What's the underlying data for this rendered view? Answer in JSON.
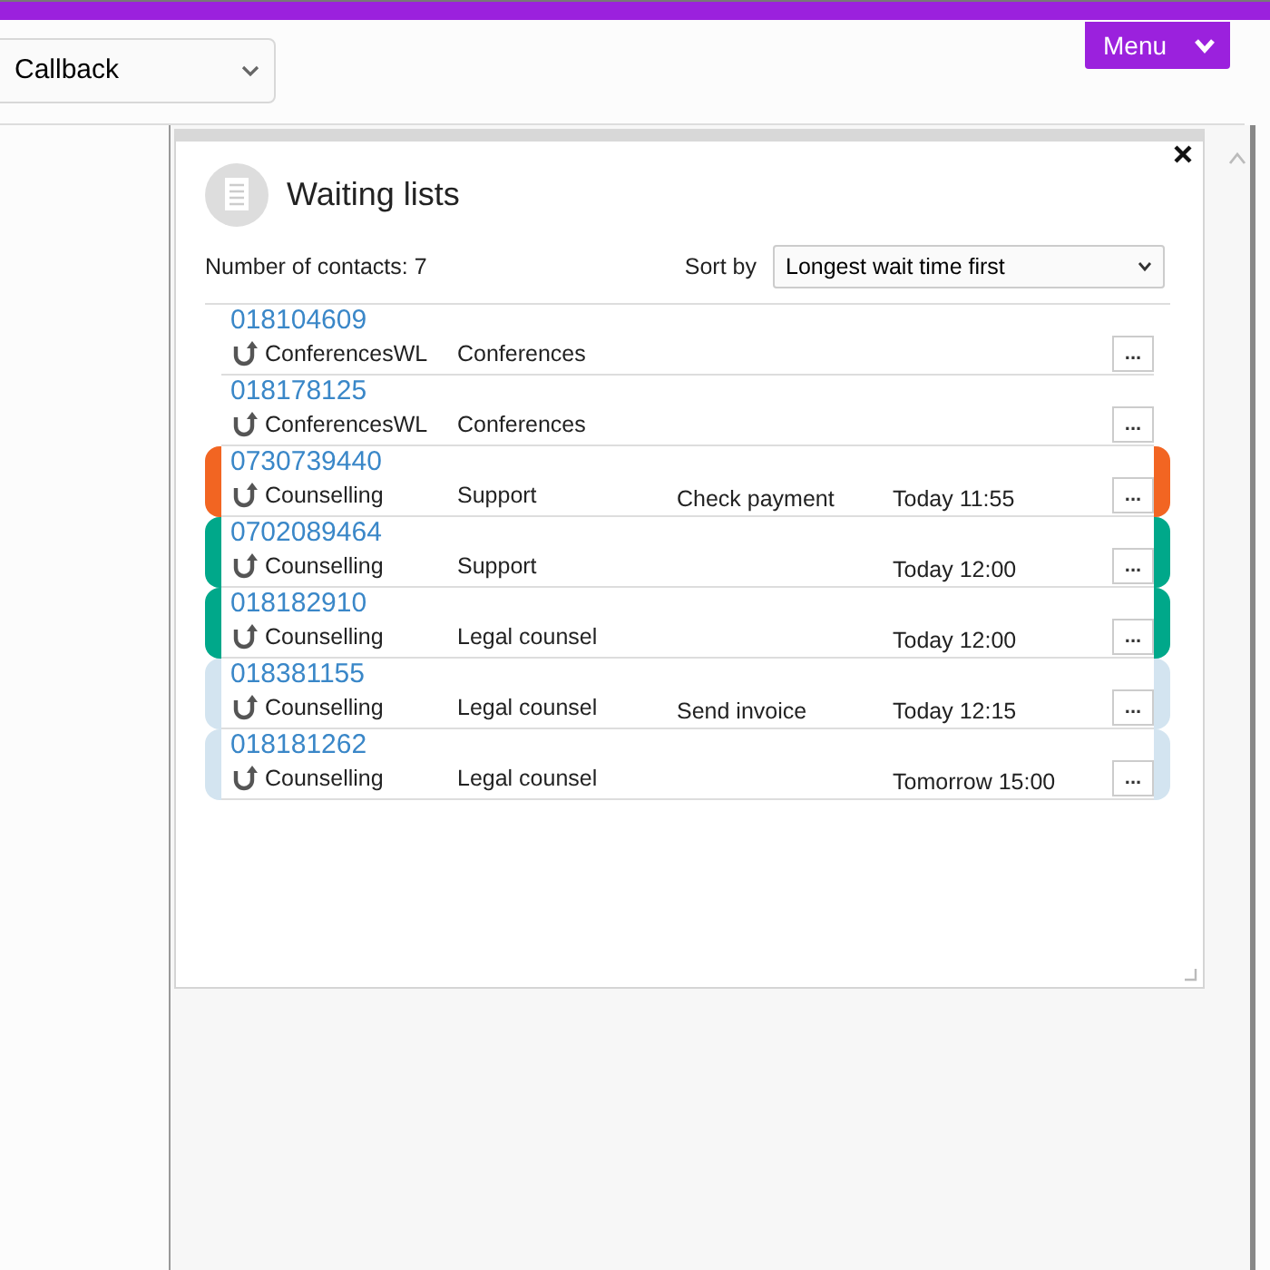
{
  "header": {
    "dropdown": {
      "value": "Callback"
    },
    "menu_button": "Menu"
  },
  "panel": {
    "title": "Waiting lists",
    "count_label": "Number of contacts: 7",
    "sort_label": "Sort by",
    "sort_value": "Longest wait time first",
    "rows": [
      {
        "number": "018104609",
        "queue": "ConferencesWL",
        "category": "Conferences",
        "more": "..."
      },
      {
        "number": "018178125",
        "queue": "ConferencesWL",
        "category": "Conferences",
        "more": "..."
      },
      {
        "number": "0730739440",
        "queue": "Counselling",
        "category": "Support",
        "note": "Check payment",
        "time": "Today 11:55",
        "color": "#f26522",
        "more": "..."
      },
      {
        "number": "0702089464",
        "queue": "Counselling",
        "category": "Support",
        "time": "Today 12:00",
        "color": "#00a88a",
        "more": "..."
      },
      {
        "number": "018182910",
        "queue": "Counselling",
        "category": "Legal counsel",
        "time": "Today 12:00",
        "color": "#00a88a",
        "more": "..."
      },
      {
        "number": "018381155",
        "queue": "Counselling",
        "category": "Legal counsel",
        "note": "Send invoice",
        "time": "Today 12:15",
        "color": "#d3e4f0",
        "more": "..."
      },
      {
        "number": "018181262",
        "queue": "Counselling",
        "category": "Legal counsel",
        "time": "Tomorrow 15:00",
        "color": "#d3e4f0",
        "more": "..."
      }
    ]
  }
}
